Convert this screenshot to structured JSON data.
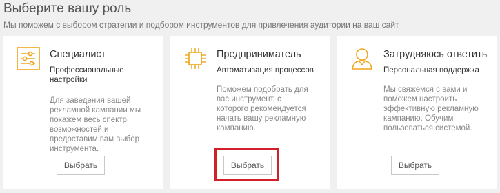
{
  "header": {
    "title": "Выберите вашу роль",
    "subtitle": "Мы поможем с выбором стратегии и подбором инструментов для привлечения аудитории на ваш сайт"
  },
  "colors": {
    "accent": "#f0a51a",
    "highlight": "#d0202a"
  },
  "cards": [
    {
      "icon": "sliders-icon",
      "title": "Специалист",
      "subtitle": "Профессиональные настройки",
      "description": "Для заведения вашей рекламной кампании мы покажем весь спектр возможностей и предоставим вам выбор инструмента.",
      "button_label": "Выбрать"
    },
    {
      "icon": "chip-icon",
      "title": "Предприниматель",
      "subtitle": "Автоматизация процессов",
      "description": "Поможем подобрать для вас инструмент, с которого рекомендуется начать вашу рекламную кампанию.",
      "button_label": "Выбрать",
      "highlighted": true
    },
    {
      "icon": "user-icon",
      "title": "Затрудняюсь ответить",
      "subtitle": "Персональная поддержка",
      "description": "Мы свяжемся с вами и поможем настроить эффективную рекламную кампанию. Обучим пользоваться системой.",
      "button_label": "Выбрать"
    }
  ]
}
